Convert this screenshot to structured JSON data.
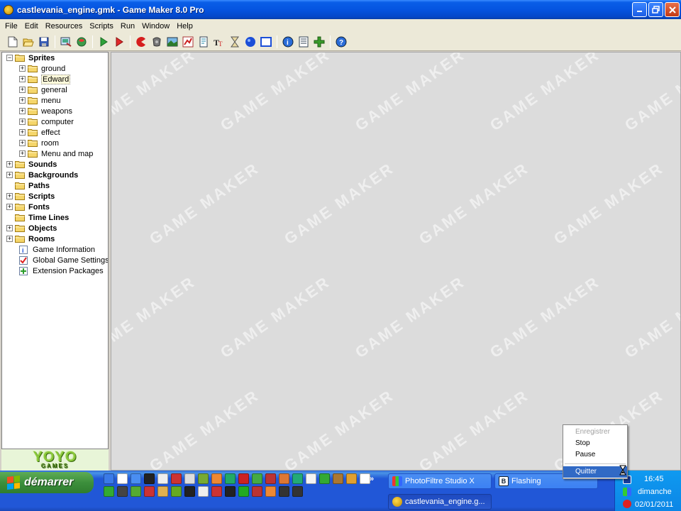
{
  "window": {
    "title": "castlevania_engine.gmk - Game Maker 8.0 Pro",
    "buttons": [
      "minimize",
      "maximize",
      "close"
    ]
  },
  "menu": [
    "File",
    "Edit",
    "Resources",
    "Scripts",
    "Run",
    "Window",
    "Help"
  ],
  "toolbar": {
    "icons": [
      "new-icon",
      "open-icon",
      "save-icon",
      "create-executable-icon",
      "publish-icon",
      "run-icon",
      "run-debug-icon",
      "add-sprite-icon",
      "add-sound-icon",
      "add-background-icon",
      "add-path-icon",
      "add-script-icon",
      "add-font-icon",
      "add-timeline-icon",
      "add-object-icon",
      "add-room-icon",
      "game-info-icon",
      "game-settings-icon",
      "extension-icon",
      "help-icon"
    ]
  },
  "tree": {
    "sprites": {
      "label": "Sprites",
      "children": [
        "ground",
        "Edward",
        "general",
        "menu",
        "weapons",
        "computer",
        "effect",
        "room",
        "Menu and map"
      ],
      "selected": "Edward"
    },
    "groups": [
      {
        "label": "Sounds",
        "expander": "+"
      },
      {
        "label": "Backgrounds",
        "expander": "+"
      },
      {
        "label": "Paths",
        "expander": ""
      },
      {
        "label": "Scripts",
        "expander": "+"
      },
      {
        "label": "Fonts",
        "expander": "+"
      },
      {
        "label": "Time Lines",
        "expander": ""
      },
      {
        "label": "Objects",
        "expander": "+"
      },
      {
        "label": "Rooms",
        "expander": "+"
      }
    ],
    "leaves": [
      {
        "label": "Game Information",
        "icon": "info-icon"
      },
      {
        "label": "Global Game Settings",
        "icon": "settings-icon"
      },
      {
        "label": "Extension Packages",
        "icon": "extension-icon"
      }
    ]
  },
  "logo": {
    "main": "YOYO",
    "sub": "GAMES"
  },
  "watermark": {
    "text": "GAME MAKER"
  },
  "taskbar": {
    "start_label": "démarrer",
    "quicklaunch_more": "»",
    "tasks": [
      {
        "label": "PhotoFiltre Studio X",
        "active": false
      },
      {
        "label": "Flashing",
        "active": false
      },
      {
        "label": "castlevania_engine.g...",
        "active": true
      }
    ],
    "clock": {
      "time": "16:45",
      "day": "dimanche",
      "date": "02/01/2011"
    }
  },
  "context_menu": {
    "items": [
      {
        "label": "Enregistrer",
        "disabled": true
      },
      {
        "label": "Stop",
        "disabled": false
      },
      {
        "label": "Pause",
        "disabled": false
      },
      {
        "label": "Quitter",
        "disabled": false,
        "highlighted": true
      }
    ]
  },
  "colors": {
    "titlebar_blue": "#0554e0",
    "taskbar_blue": "#2157d7",
    "start_green": "#3c8f3c",
    "folder_yellow": "#f5d66b",
    "menu_highlight": "#316ac5"
  }
}
